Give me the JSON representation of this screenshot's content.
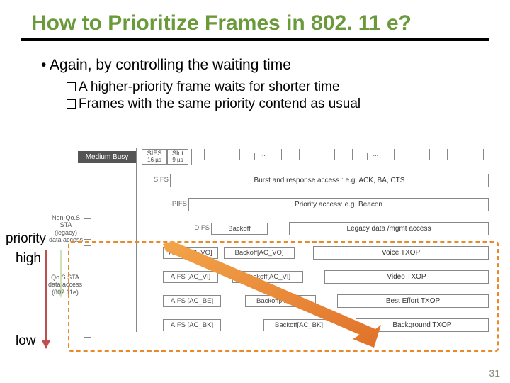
{
  "title": "How to Prioritize Frames in 802. 11 e?",
  "bullets": {
    "b1": "Again, by controlling the waiting time",
    "b2a": "A higher-priority frame waits for shorter time",
    "b2b": "Frames with the same priority contend as usual"
  },
  "diagram": {
    "medium_busy": "Medium Busy",
    "sifs_small": "SIFS",
    "sifs_us": "16 µs",
    "slot_small": "Slot",
    "slot_us": "9 µs",
    "dots": "...",
    "rows": {
      "sifs": {
        "label": "SIFS",
        "text": "Burst and response access : e.g. ACK, BA, CTS"
      },
      "pifs": {
        "label": "PIFS",
        "text": "Priority access: e.g. Beacon"
      },
      "difs": {
        "label": "DIFS",
        "backoff": "Backoff",
        "text": "Legacy data /mgmt access"
      },
      "vo": {
        "label": "AIFS [AC_VO]",
        "backoff": "Backoff[AC_VO]",
        "text": "Voice TXOP"
      },
      "vi": {
        "label": "AIFS [AC_VI]",
        "backoff": "Backoff[AC_VI]",
        "text": "Video TXOP"
      },
      "be": {
        "label": "AIFS [AC_BE]",
        "backoff": "Backoff[AC_BE]",
        "text": "Best Effort TXOP"
      },
      "bk": {
        "label": "AIFS [AC_BK]",
        "backoff": "Backoff[AC_BK]",
        "text": "Background TXOP"
      }
    },
    "legacy_bracket": "Non-Qo.S STA (legacy) data access",
    "qos_bracket": "Qo.S STA data access (802.11e)"
  },
  "labels": {
    "priority": "priority",
    "high": "high",
    "low": "low"
  },
  "page_number": "31"
}
